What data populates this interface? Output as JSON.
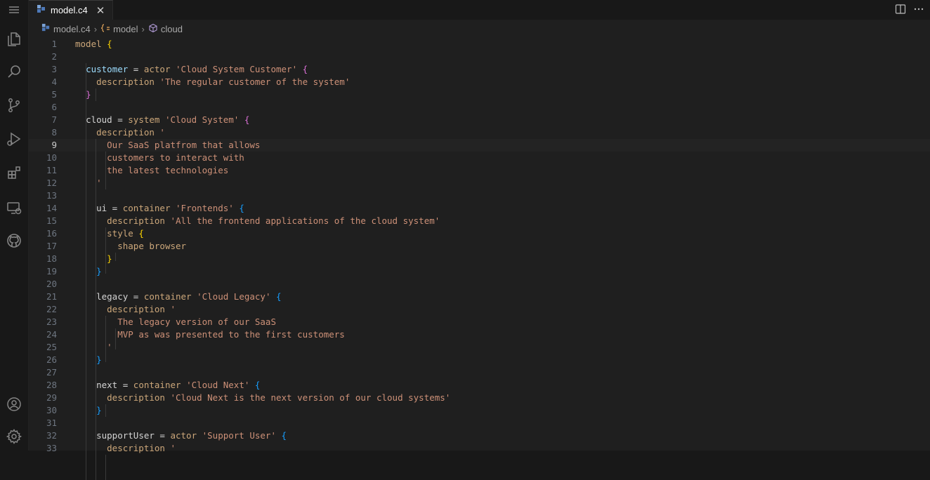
{
  "tab": {
    "label": "model.c4",
    "close": "✕"
  },
  "breadcrumb": {
    "file": "model.c4",
    "model": "model",
    "element": "cloud"
  },
  "editor": {
    "current_line": 9,
    "lines": [
      {
        "n": "1",
        "tokens": [
          [
            "kw",
            "model "
          ],
          [
            "by",
            "{"
          ]
        ]
      },
      {
        "n": "2",
        "tokens": []
      },
      {
        "n": "3",
        "tokens": [
          [
            "sp",
            "  "
          ],
          [
            "id",
            "customer"
          ],
          [
            "plain",
            " = "
          ],
          [
            "kw",
            "actor "
          ],
          [
            "str",
            "'Cloud System Customer'"
          ],
          [
            "plain",
            " "
          ],
          [
            "bp",
            "{"
          ]
        ]
      },
      {
        "n": "4",
        "tokens": [
          [
            "sp",
            "    "
          ],
          [
            "kw",
            "description "
          ],
          [
            "str",
            "'The regular customer of the system'"
          ]
        ]
      },
      {
        "n": "5",
        "tokens": [
          [
            "sp",
            "  "
          ],
          [
            "bp",
            "}"
          ]
        ]
      },
      {
        "n": "6",
        "tokens": []
      },
      {
        "n": "7",
        "tokens": [
          [
            "sp",
            "  "
          ],
          [
            "plain",
            "cloud = "
          ],
          [
            "kw",
            "system "
          ],
          [
            "str",
            "'Cloud System'"
          ],
          [
            "plain",
            " "
          ],
          [
            "bp",
            "{"
          ]
        ]
      },
      {
        "n": "8",
        "tokens": [
          [
            "sp",
            "    "
          ],
          [
            "kw",
            "description "
          ],
          [
            "str",
            "'"
          ]
        ]
      },
      {
        "n": "9",
        "tokens": [
          [
            "sp",
            "      "
          ],
          [
            "str",
            "Our SaaS platfrom that allows"
          ]
        ]
      },
      {
        "n": "10",
        "tokens": [
          [
            "sp",
            "      "
          ],
          [
            "str",
            "customers to interact with"
          ]
        ]
      },
      {
        "n": "11",
        "tokens": [
          [
            "sp",
            "      "
          ],
          [
            "str",
            "the latest technologies"
          ]
        ]
      },
      {
        "n": "12",
        "tokens": [
          [
            "sp",
            "    "
          ],
          [
            "str",
            "'"
          ]
        ]
      },
      {
        "n": "13",
        "tokens": []
      },
      {
        "n": "14",
        "tokens": [
          [
            "sp",
            "    "
          ],
          [
            "plain",
            "ui = "
          ],
          [
            "kw",
            "container "
          ],
          [
            "str",
            "'Frontends'"
          ],
          [
            "plain",
            " "
          ],
          [
            "bb",
            "{"
          ]
        ]
      },
      {
        "n": "15",
        "tokens": [
          [
            "sp",
            "      "
          ],
          [
            "kw",
            "description "
          ],
          [
            "str",
            "'All the frontend applications of the cloud system'"
          ]
        ]
      },
      {
        "n": "16",
        "tokens": [
          [
            "sp",
            "      "
          ],
          [
            "kw",
            "style "
          ],
          [
            "by",
            "{"
          ]
        ]
      },
      {
        "n": "17",
        "tokens": [
          [
            "sp",
            "        "
          ],
          [
            "kw",
            "shape browser"
          ]
        ]
      },
      {
        "n": "18",
        "tokens": [
          [
            "sp",
            "      "
          ],
          [
            "by",
            "}"
          ]
        ]
      },
      {
        "n": "19",
        "tokens": [
          [
            "sp",
            "    "
          ],
          [
            "bb",
            "}"
          ]
        ]
      },
      {
        "n": "20",
        "tokens": []
      },
      {
        "n": "21",
        "tokens": [
          [
            "sp",
            "    "
          ],
          [
            "plain",
            "legacy = "
          ],
          [
            "kw",
            "container "
          ],
          [
            "str",
            "'Cloud Legacy'"
          ],
          [
            "plain",
            " "
          ],
          [
            "bb",
            "{"
          ]
        ]
      },
      {
        "n": "22",
        "tokens": [
          [
            "sp",
            "      "
          ],
          [
            "kw",
            "description "
          ],
          [
            "str",
            "'"
          ]
        ]
      },
      {
        "n": "23",
        "tokens": [
          [
            "sp",
            "        "
          ],
          [
            "str",
            "The legacy version of our SaaS"
          ]
        ]
      },
      {
        "n": "24",
        "tokens": [
          [
            "sp",
            "        "
          ],
          [
            "str",
            "MVP as was presented to the first customers"
          ]
        ]
      },
      {
        "n": "25",
        "tokens": [
          [
            "sp",
            "      "
          ],
          [
            "str",
            "'"
          ]
        ]
      },
      {
        "n": "26",
        "tokens": [
          [
            "sp",
            "    "
          ],
          [
            "bb",
            "}"
          ]
        ]
      },
      {
        "n": "27",
        "tokens": []
      },
      {
        "n": "28",
        "tokens": [
          [
            "sp",
            "    "
          ],
          [
            "plain",
            "next = "
          ],
          [
            "kw",
            "container "
          ],
          [
            "str",
            "'Cloud Next'"
          ],
          [
            "plain",
            " "
          ],
          [
            "bb",
            "{"
          ]
        ]
      },
      {
        "n": "29",
        "tokens": [
          [
            "sp",
            "      "
          ],
          [
            "kw",
            "description "
          ],
          [
            "str",
            "'Cloud Next is the next version of our cloud systems'"
          ]
        ]
      },
      {
        "n": "30",
        "tokens": [
          [
            "sp",
            "    "
          ],
          [
            "bb",
            "}"
          ]
        ]
      },
      {
        "n": "31",
        "tokens": []
      },
      {
        "n": "32",
        "tokens": [
          [
            "sp",
            "    "
          ],
          [
            "plain",
            "supportUser = "
          ],
          [
            "kw",
            "actor "
          ],
          [
            "str",
            "'Support User'"
          ],
          [
            "plain",
            " "
          ],
          [
            "bb",
            "{"
          ]
        ]
      },
      {
        "n": "33",
        "tokens": [
          [
            "sp",
            "      "
          ],
          [
            "kw",
            "description "
          ],
          [
            "str",
            "'"
          ]
        ]
      }
    ]
  },
  "icons": {
    "activity": [
      "menu-icon",
      "explorer-icon",
      "search-icon",
      "source-control-icon",
      "run-debug-icon",
      "extensions-icon",
      "remote-explorer-icon",
      "github-icon",
      "account-icon",
      "settings-gear-icon"
    ]
  }
}
